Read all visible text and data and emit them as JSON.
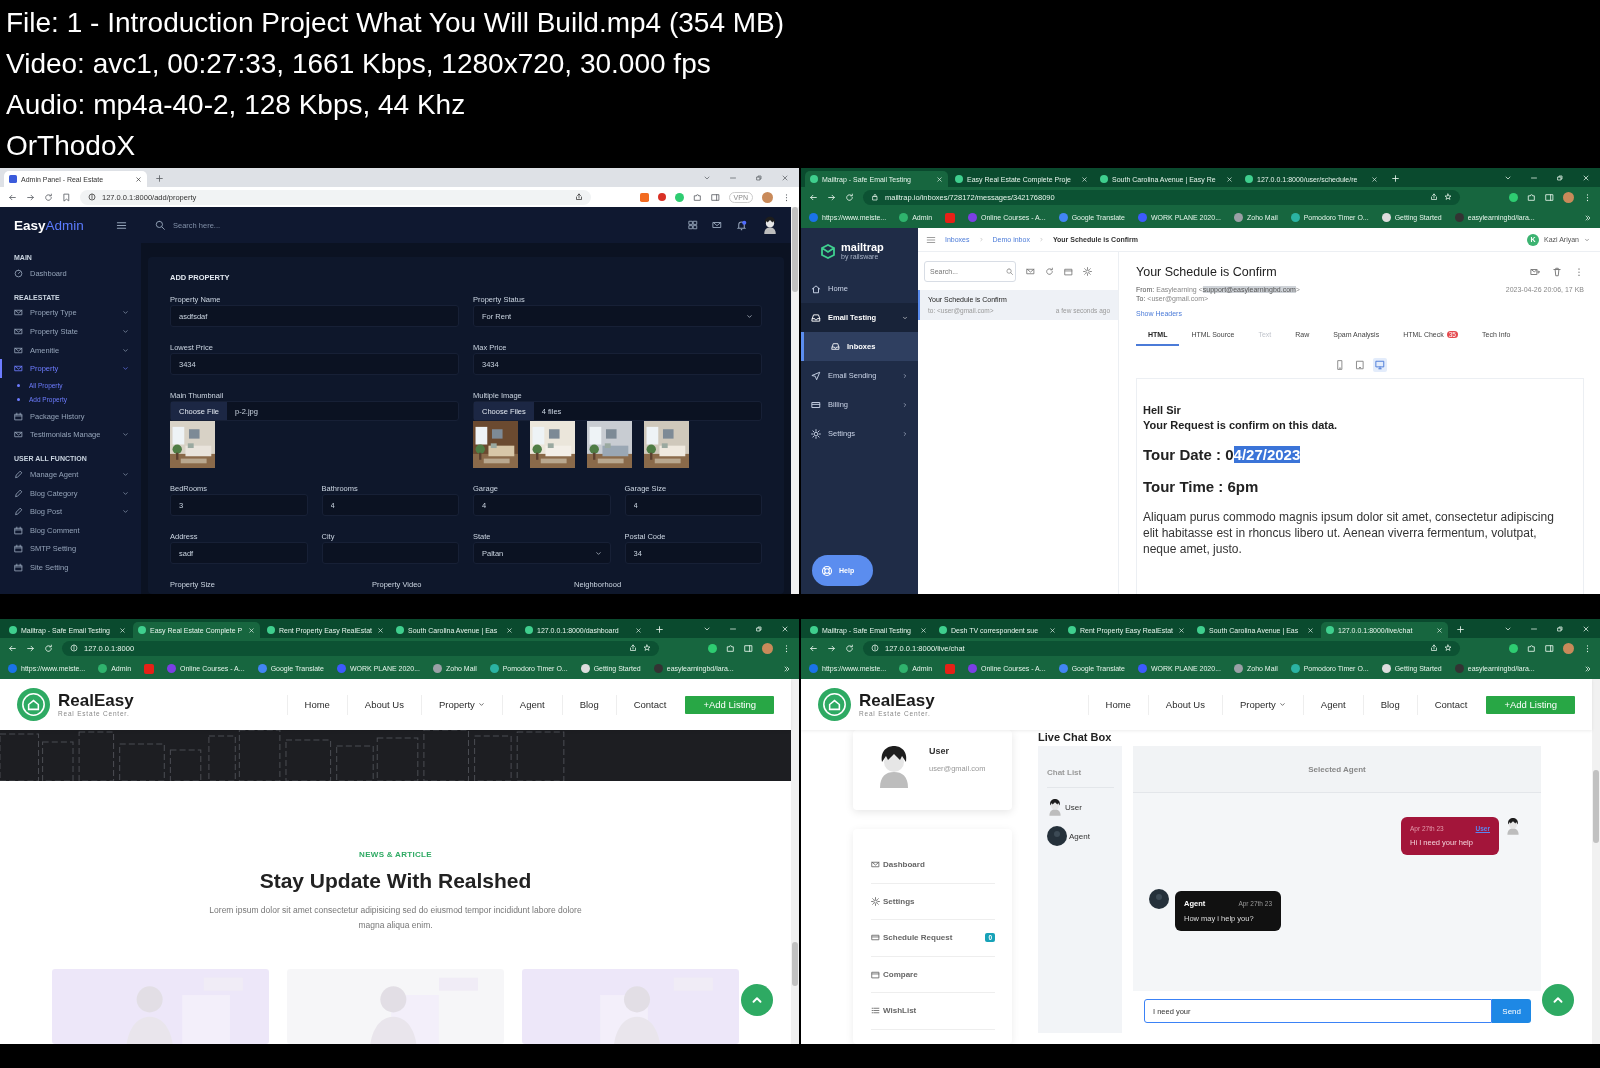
{
  "video_info": {
    "lines": [
      "File: 1 - Introduction Project What You Will Build.mp4 (354 MB)",
      "Video: avc1, 00:27:33, 1661 Kbps, 1280x720, 30.000 fps",
      "Audio: mp4a-40-2, 128 Kbps, 44 Khz",
      "OrThodoX"
    ]
  },
  "panels": [
    {
      "kind": "admin",
      "browser": {
        "themed": false,
        "secure": false,
        "vpn": "VPN",
        "tabs": [
          {
            "title": "Admin Panel - Real Estate",
            "selected": true
          }
        ],
        "url": "127.0.0.1:8000/add/property"
      },
      "brand": {
        "first": "Easy",
        "second": "Admin"
      },
      "search": {
        "placeholder": "Search here..."
      },
      "sidebar": [
        {
          "heading": "MAIN",
          "items": [
            {
              "label": "Dashboard",
              "caret": false,
              "selected": false
            }
          ]
        },
        {
          "heading": "REALESTATE",
          "items": [
            {
              "label": "Property Type",
              "caret": true,
              "selected": false
            },
            {
              "label": "Property State",
              "caret": true,
              "selected": false
            },
            {
              "label": "Amenitie",
              "caret": true,
              "selected": false
            },
            {
              "label": "Property",
              "caret": true,
              "selected": true,
              "children": [
                {
                  "label": "All Property",
                  "selected": false
                },
                {
                  "label": "Add Property",
                  "selected": false
                }
              ]
            },
            {
              "label": "Package History",
              "caret": false,
              "selected": false
            },
            {
              "label": "Testimonials Manage",
              "caret": true,
              "selected": false
            }
          ]
        },
        {
          "heading": "USER ALL FUNCTION",
          "items": [
            {
              "label": "Manage Agent",
              "caret": true,
              "selected": false
            },
            {
              "label": "Blog Category",
              "caret": true,
              "selected": false
            },
            {
              "label": "Blog Post",
              "caret": true,
              "selected": false
            },
            {
              "label": "Blog Comment",
              "caret": false,
              "selected": false
            },
            {
              "label": "SMTP Setting",
              "caret": false,
              "selected": false
            },
            {
              "label": "Site Setting",
              "caret": false,
              "selected": false
            }
          ]
        }
      ],
      "form": {
        "title": "ADD PROPERTY",
        "rows": [
          [
            {
              "kind": "text",
              "label": "Property Name",
              "value": "asdfsdaf"
            },
            {
              "kind": "select",
              "label": "Property Status",
              "value": "For Rent"
            }
          ],
          [
            {
              "kind": "text",
              "label": "Lowest Price",
              "value": "3434"
            },
            {
              "kind": "text",
              "label": "Max Price",
              "value": "3434"
            }
          ],
          [
            {
              "kind": "file",
              "label": "Main Thumbnail",
              "button": "Choose File",
              "value": "p-2.jpg"
            },
            {
              "kind": "file",
              "label": "Multiple Image",
              "button": "Choose Files",
              "value": "4 files"
            }
          ],
          [
            {
              "kind": "text",
              "label": "BedRooms",
              "value": "3"
            },
            {
              "kind": "text",
              "label": "Bathrooms",
              "value": "4"
            },
            {
              "kind": "text",
              "label": "Garage",
              "value": "4"
            },
            {
              "kind": "text",
              "label": "Garage Size",
              "value": "4"
            }
          ],
          [
            {
              "kind": "text",
              "label": "Address",
              "value": "sadf"
            },
            {
              "kind": "text",
              "label": "City"
            },
            {
              "kind": "select",
              "label": "State",
              "value": "Paltan"
            },
            {
              "kind": "text",
              "label": "Postal Code",
              "value": "34"
            }
          ],
          [
            {
              "kind": "label",
              "label": "Property Size"
            },
            {
              "kind": "label",
              "label": "Property Video"
            },
            {
              "kind": "label",
              "label": "Neighborhood"
            }
          ]
        ]
      }
    },
    {
      "kind": "mailtrap",
      "browser": {
        "themed": true,
        "secure": true,
        "tabs": [
          {
            "title": "Mailtrap - Safe Email Testing",
            "selected": true
          },
          {
            "title": "Easy Real Estate Complete Proje",
            "selected": false
          },
          {
            "title": "South Carolina Avenue | Easy Re",
            "selected": false
          },
          {
            "title": "127.0.0.1:8000/user/schedule/re",
            "selected": false
          }
        ],
        "url": "mailtrap.io/inboxes/728172/messages/3421768090",
        "bookmarks": [
          {
            "kind": "link",
            "label": "https://www.meiste..."
          },
          {
            "kind": "link",
            "label": "Admin"
          },
          {
            "kind": "icon"
          },
          {
            "kind": "link",
            "label": "Online Courses - A..."
          },
          {
            "kind": "link",
            "label": "Google Translate"
          },
          {
            "kind": "link",
            "label": "WORK PLANE 2020..."
          },
          {
            "kind": "link",
            "label": "Zoho Mail"
          },
          {
            "kind": "link",
            "label": "Pomodoro Timer O..."
          },
          {
            "kind": "link",
            "label": "Getting Started"
          },
          {
            "kind": "link",
            "label": "easylearningbd/lara..."
          }
        ]
      },
      "logo": {
        "name": "mailtrap",
        "tagline": "by railsware"
      },
      "nav": [
        {
          "label": "Home",
          "caret": false,
          "expanded": false
        },
        {
          "label": "Email Testing",
          "caret": true,
          "expanded": true,
          "children": [
            {
              "label": "Inboxes",
              "selected": true
            }
          ]
        },
        {
          "label": "Email Sending",
          "caret": true,
          "expanded": false
        },
        {
          "label": "Billing",
          "caret": true,
          "expanded": false
        },
        {
          "label": "Settings",
          "caret": true,
          "expanded": false
        }
      ],
      "help": "Help",
      "breadcrumb": [
        "Inboxes",
        "Demo inbox",
        "Your Schedule is Confirm"
      ],
      "account": {
        "initial": "K",
        "name": "Kazi Ariyan"
      },
      "list_search": {
        "placeholder": "Search..."
      },
      "messages": [
        {
          "subject": "Your Schedule is Confirm",
          "to": "to: <user@gmail.com>",
          "time": "a few seconds ago",
          "selected": true
        }
      ],
      "message": {
        "subject": "Your Schedule is Confirm",
        "from": {
          "label": "From:",
          "parts": [
            {
              "text": "Easylearning <",
              "highlight": false
            },
            {
              "text": "support@easylearningbd.com",
              "highlight": true
            },
            {
              "text": ">",
              "highlight": false
            }
          ]
        },
        "date": "2023-04-26 20:06, 17 KB",
        "to": {
          "label": "To:",
          "text": "<user@gmail.com>"
        },
        "show_headers": "Show Headers",
        "tabs": [
          {
            "label": "HTML",
            "selected": true,
            "disabled": false
          },
          {
            "label": "HTML Source",
            "selected": false,
            "disabled": false
          },
          {
            "label": "Text",
            "selected": false,
            "disabled": true
          },
          {
            "label": "Raw",
            "selected": false,
            "disabled": false
          },
          {
            "label": "Spam Analysis",
            "selected": false,
            "disabled": false
          },
          {
            "label": "HTML Check",
            "selected": false,
            "disabled": false,
            "badge": "35"
          },
          {
            "label": "Tech Info",
            "selected": false,
            "disabled": false
          }
        ],
        "views": [
          {
            "kind": "phone",
            "selected": false
          },
          {
            "kind": "tablet",
            "selected": false
          },
          {
            "kind": "desktop",
            "selected": true
          }
        ],
        "body": [
          {
            "kind": "line",
            "text": "Hell Sir"
          },
          {
            "kind": "line",
            "text": "Your Request is confirm on this data."
          },
          {
            "kind": "heading",
            "parts": [
              {
                "text": "Tour Date : 0",
                "highlight": false
              },
              {
                "text": "4/27/2023",
                "highlight": true
              }
            ]
          },
          {
            "kind": "heading",
            "text": "Tour Time : 6pm"
          },
          {
            "kind": "paragraph",
            "text": "Aliquam purus commodo magnis ipsum dolor sit amet, consectetur adipiscing elit habitasse est in rhoncus libero ut. Aenean viverra fermentum, volutpat, neque amet, justo."
          }
        ]
      }
    },
    {
      "kind": "home",
      "browser": {
        "themed": true,
        "secure": false,
        "tabs": [
          {
            "title": "Mailtrap - Safe Email Testing",
            "selected": false
          },
          {
            "title": "Easy Real Estate Complete P",
            "selected": true
          },
          {
            "title": "Rent Property Easy RealEstat",
            "selected": false
          },
          {
            "title": "South Carolina Avenue | Eas",
            "selected": false
          },
          {
            "title": "127.0.0.1:8000/dashboard",
            "selected": false
          }
        ],
        "url": "127.0.0.1:8000",
        "bookmarks": [
          {
            "kind": "link",
            "label": "https://www.meiste..."
          },
          {
            "kind": "link",
            "label": "Admin"
          },
          {
            "kind": "icon"
          },
          {
            "kind": "link",
            "label": "Online Courses - A..."
          },
          {
            "kind": "link",
            "label": "Google Translate"
          },
          {
            "kind": "link",
            "label": "WORK PLANE 2020..."
          },
          {
            "kind": "link",
            "label": "Zoho Mail"
          },
          {
            "kind": "link",
            "label": "Pomodoro Timer O..."
          },
          {
            "kind": "link",
            "label": "Getting Started"
          },
          {
            "kind": "link",
            "label": "easylearningbd/lara..."
          }
        ]
      },
      "site_nav": {
        "brand": "RealEasy",
        "tagline": "Real Estate Center.",
        "links": [
          {
            "label": "Home",
            "caret": false
          },
          {
            "label": "About Us",
            "caret": false
          },
          {
            "label": "Property",
            "caret": true
          },
          {
            "label": "Agent",
            "caret": false
          },
          {
            "label": "Blog",
            "caret": false
          },
          {
            "label": "Contact",
            "caret": false
          }
        ],
        "cta": "+Add Listing"
      },
      "section": {
        "eyebrow": "NEWS & ARTICLE",
        "title": "Stay Update With Realshed",
        "text": "Lorem ipsum dolor sit amet consectetur adipisicing sed do eiusmod tempor incididunt labore dolore magna aliqua enim."
      }
    },
    {
      "kind": "chat",
      "browser": {
        "themed": true,
        "secure": false,
        "tabs": [
          {
            "title": "Mailtrap - Safe Email Testing",
            "selected": false
          },
          {
            "title": "Desh TV correspondent sue",
            "selected": false
          },
          {
            "title": "Rent Property Easy RealEstat",
            "selected": false
          },
          {
            "title": "South Carolina Avenue | Eas",
            "selected": false
          },
          {
            "title": "127.0.0.1:8000/live/chat",
            "selected": true
          }
        ],
        "url": "127.0.0.1:8000/live/chat",
        "bookmarks": [
          {
            "kind": "link",
            "label": "https://www.meiste..."
          },
          {
            "kind": "link",
            "label": "Admin"
          },
          {
            "kind": "icon"
          },
          {
            "kind": "link",
            "label": "Online Courses - A..."
          },
          {
            "kind": "link",
            "label": "Google Translate"
          },
          {
            "kind": "link",
            "label": "WORK PLANE 2020..."
          },
          {
            "kind": "link",
            "label": "Zoho Mail"
          },
          {
            "kind": "link",
            "label": "Pomodoro Timer O..."
          },
          {
            "kind": "link",
            "label": "Getting Started"
          },
          {
            "kind": "link",
            "label": "easylearningbd/lara..."
          }
        ]
      },
      "site_nav": {
        "brand": "RealEasy",
        "tagline": "Real Estate Center.",
        "links": [
          {
            "label": "Home",
            "caret": false
          },
          {
            "label": "About Us",
            "caret": false
          },
          {
            "label": "Property",
            "caret": true
          },
          {
            "label": "Agent",
            "caret": false
          },
          {
            "label": "Blog",
            "caret": false
          },
          {
            "label": "Contact",
            "caret": false
          }
        ],
        "cta": "+Add Listing"
      },
      "heading": "Live Chat Box",
      "profile": {
        "name": "User",
        "email": "user@gmail.com"
      },
      "menu": [
        {
          "label": "Dashboard"
        },
        {
          "label": "Settings"
        },
        {
          "label": "Schedule Request",
          "badge": "0"
        },
        {
          "label": "Compare"
        },
        {
          "label": "WishList"
        }
      ],
      "chat_list": {
        "title": "Chat List",
        "contacts": [
          {
            "kind": "user",
            "name": "User"
          },
          {
            "kind": "agent",
            "name": "Agent"
          }
        ]
      },
      "chat": {
        "title": "Selected Agent",
        "messages": [
          {
            "kind": "sent",
            "name": "User",
            "time": "Apr 27th 23",
            "text": "Hi I need your help"
          },
          {
            "kind": "received",
            "name": "Agent",
            "time": "Apr 27th 23",
            "text": "How may i help you?"
          }
        ],
        "input_value": "I need your",
        "send": "Send"
      }
    }
  ]
}
